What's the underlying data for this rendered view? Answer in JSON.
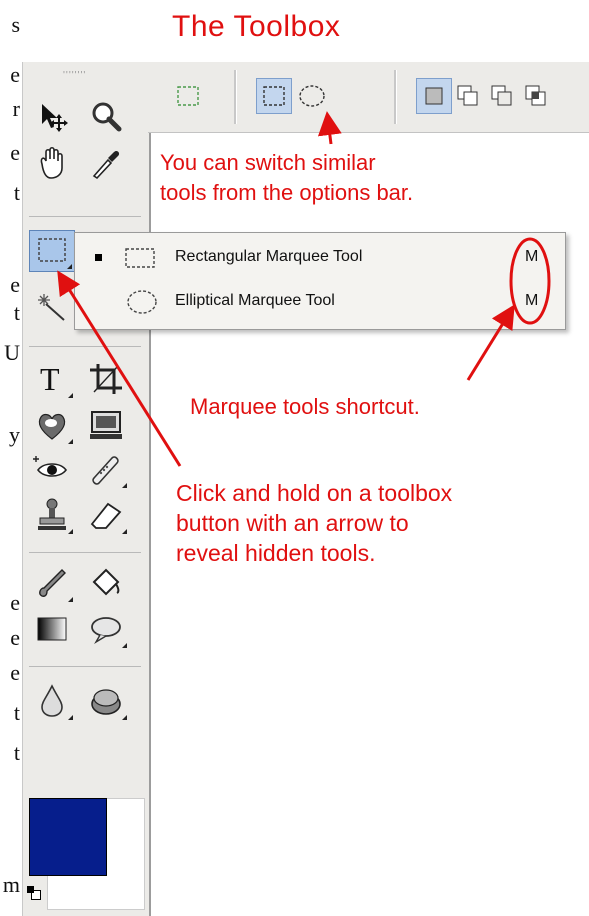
{
  "page_title": "The Toolbox",
  "left_edge_letters": [
    "s",
    "e",
    "r",
    "e",
    "t",
    "e",
    "t",
    "U",
    "y",
    "",
    "",
    "e",
    "e",
    "e",
    "t",
    "t",
    "",
    "m"
  ],
  "flyout": {
    "items": [
      {
        "label": "Rectangular Marquee Tool",
        "shortcut": "M",
        "selected": true
      },
      {
        "label": "Elliptical Marquee Tool",
        "shortcut": "M",
        "selected": false
      }
    ]
  },
  "annotations": {
    "options_bar": [
      "You can switch similar",
      "tools from the options bar."
    ],
    "shortcut": "Marquee tools shortcut.",
    "hold": [
      "Click and hold on a toolbox",
      "button with an arrow to",
      "reveal hidden tools."
    ]
  },
  "colors": {
    "annotation_red": "#e01010",
    "foreground_swatch": "#061e8c",
    "background_swatch": "#ffffff",
    "selected_tool_bg": "#a9c6ea"
  },
  "icons": {
    "tools_left": [
      "move-tool-icon",
      "lasso-hand-icon",
      "marquee-tool-icon",
      "magic-wand-icon",
      "type-tool-icon",
      "healing-brush-icon",
      "spot-healing-icon",
      "stamp-tool-icon",
      "brush-tool-icon",
      "gradient-tool-icon",
      "blur-tool-icon"
    ],
    "tools_right": [
      "zoom-tool-icon",
      "eyedropper-icon",
      "crop-tool-icon",
      "screen-mode-icon",
      "patch-tool-icon",
      "eraser-tool-icon",
      "paint-bucket-icon",
      "speech-bubble-icon",
      "sponge-tool-icon"
    ]
  }
}
